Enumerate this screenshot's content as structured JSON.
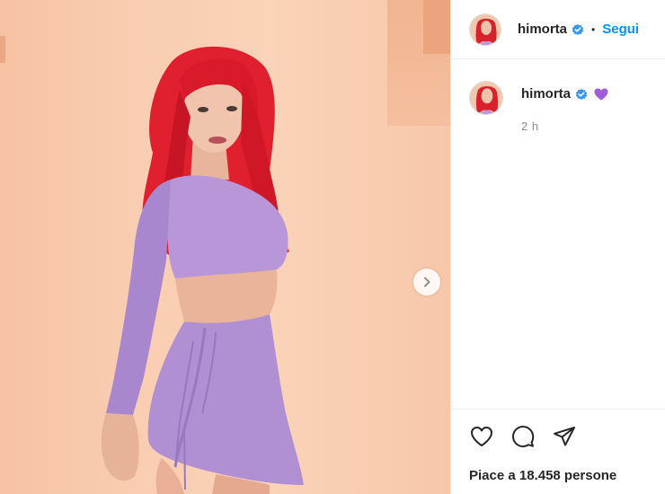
{
  "post": {
    "username": "himorta",
    "follow_label": "Segui",
    "separator": "•",
    "caption_emoji": "purple-heart",
    "time": "2 h",
    "likes_text": "Piace a 18.458 persone"
  },
  "colors": {
    "accent": "#0095f6",
    "verified": "#3897f0",
    "text": "#262626",
    "muted": "#8e8e8e",
    "heart_emoji": "#a05cd6"
  },
  "icons": {
    "like": "heart-icon",
    "comment": "comment-icon",
    "share": "share-icon",
    "next": "chevron-right-icon",
    "verified": "verified-badge-icon"
  }
}
